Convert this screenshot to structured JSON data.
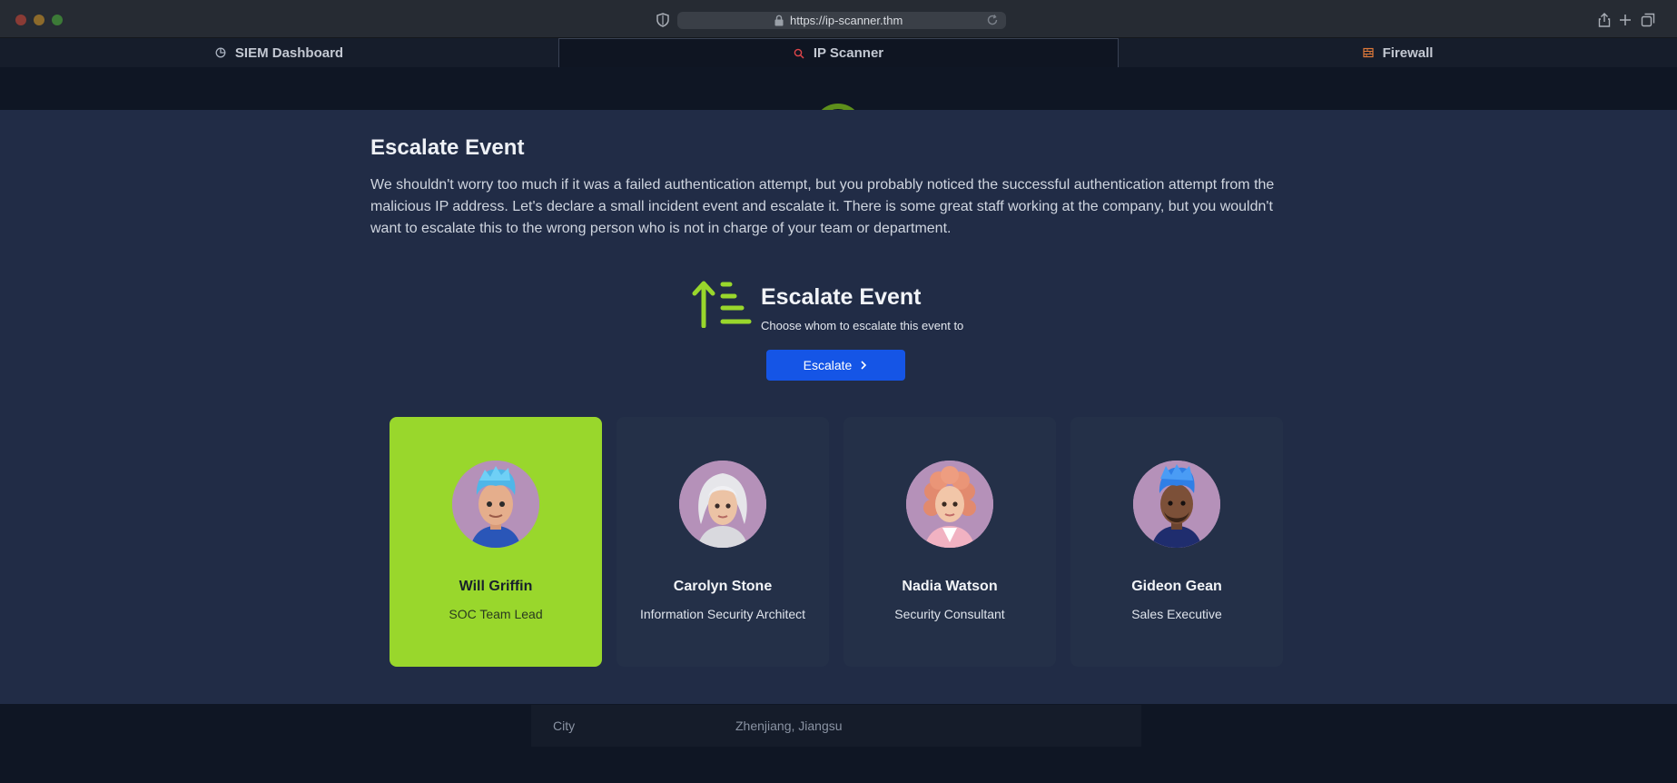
{
  "browser": {
    "url": "https://ip-scanner.thm"
  },
  "tabs": [
    {
      "label": "SIEM Dashboard",
      "icon": "chart-pie-icon",
      "icon_color": "#a7afbd"
    },
    {
      "label": "IP Scanner",
      "icon": "search-icon",
      "icon_color": "#e0454a"
    },
    {
      "label": "Firewall",
      "icon": "firewall-icon",
      "icon_color": "#e07a3a"
    }
  ],
  "background_table": {
    "label": "City",
    "value": "Zhenjiang, Jiangsu"
  },
  "modal": {
    "title": "Escalate Event",
    "text": "We shouldn't worry too much if it was a failed authentication attempt, but you probably noticed the successful authentication attempt from the malicious IP address. Let's declare a small incident event and escalate it. There is some great staff working at the company, but you wouldn't want to escalate this to the wrong person who is not in charge of your team or department.",
    "header_title": "Escalate Event",
    "header_subtitle": "Choose whom to escalate this event to",
    "button_label": "Escalate",
    "accent_color": "#99d72c",
    "button_color": "#1555e6"
  },
  "people": [
    {
      "name": "Will Griffin",
      "role": "SOC Team Lead",
      "selected": true
    },
    {
      "name": "Carolyn Stone",
      "role": "Information Security Architect",
      "selected": false
    },
    {
      "name": "Nadia Watson",
      "role": "Security Consultant",
      "selected": false
    },
    {
      "name": "Gideon Gean",
      "role": "Sales Executive",
      "selected": false
    }
  ]
}
